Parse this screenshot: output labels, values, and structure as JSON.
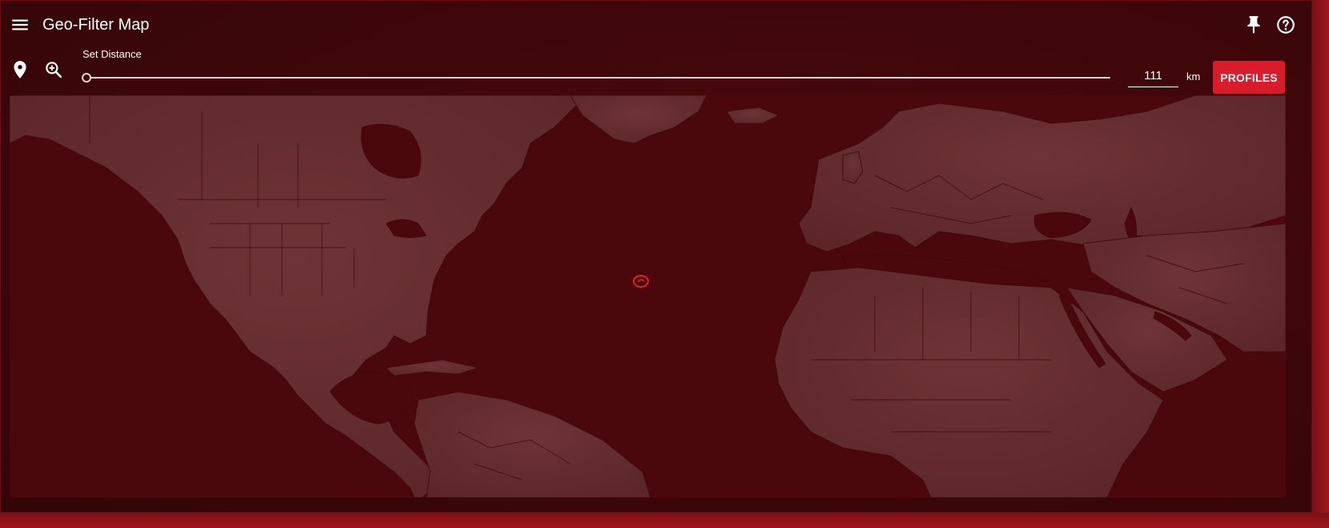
{
  "app": {
    "title": "Geo-Filter Map"
  },
  "header": {
    "menu_icon": "hamburger-menu-icon",
    "pin_icon": "pin-icon",
    "help_icon": "help-circle-icon"
  },
  "toolbar": {
    "location_icon": "map-marker-icon",
    "zoom_icon": "zoom-in-icon",
    "distance_label": "Set Distance",
    "slider_value_fraction": 0.0,
    "distance_value": "111",
    "distance_unit": "km",
    "profiles_label": "PROFILES"
  },
  "map": {
    "land_color": "#6e3336",
    "water_color": "#4a080d",
    "border_color": "#3b080b",
    "marker_color": "#e0202c",
    "marker_icon": "location-circle-marker"
  },
  "colors": {
    "accent": "#d91c2b",
    "background": "#3c070a",
    "text": "#ffffff"
  }
}
